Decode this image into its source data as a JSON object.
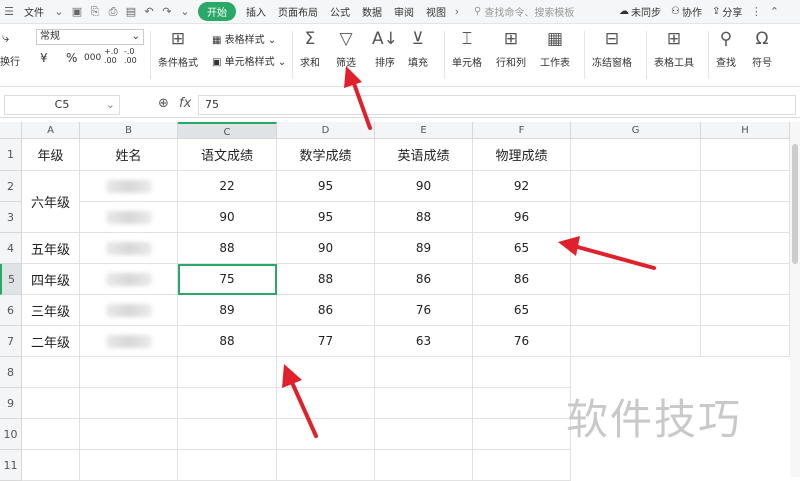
{
  "menu": {
    "file": "文件",
    "start": "开始",
    "tabs": [
      "插入",
      "页面布局",
      "公式",
      "数据",
      "审阅",
      "视图"
    ],
    "search_placeholder": "查找命令、搜索模板",
    "sync": "未同步",
    "collab": "协作",
    "share": "分享"
  },
  "ribbon": {
    "wrap": "换行",
    "format_value": "常规",
    "currency": "¥",
    "percent": "%",
    "thousands": "000",
    "dec_inc": "+.0 .00",
    "dec_dec": "-.0 .00",
    "cond_format": "条件格式",
    "table_style": "表格样式",
    "cell_style": "单元格样式",
    "sum": "求和",
    "filter": "筛选",
    "sort": "排序",
    "fill": "填充",
    "cell": "单元格",
    "row_col": "行和列",
    "sheet": "工作表",
    "freeze": "冻结窗格",
    "table_tools": "表格工具",
    "find": "查找",
    "symbol": "符号"
  },
  "formula_bar": {
    "name_box": "C5",
    "fx": "fx",
    "value": "75"
  },
  "columns": [
    "A",
    "B",
    "C",
    "D",
    "E",
    "F",
    "G",
    "H"
  ],
  "rows": [
    "1",
    "2",
    "3",
    "4",
    "5",
    "6",
    "7",
    "8",
    "9",
    "10",
    "11"
  ],
  "sheet": {
    "headers": [
      "年级",
      "姓名",
      "语文成绩",
      "数学成绩",
      "英语成绩",
      "物理成绩"
    ],
    "grades": [
      "六年级",
      "五年级",
      "四年级",
      "三年级",
      "二年级"
    ],
    "data": [
      [
        "22",
        "95",
        "90",
        "92"
      ],
      [
        "90",
        "95",
        "88",
        "96"
      ],
      [
        "88",
        "90",
        "89",
        "65"
      ],
      [
        "75",
        "88",
        "86",
        "86"
      ],
      [
        "89",
        "86",
        "76",
        "65"
      ],
      [
        "88",
        "77",
        "63",
        "76"
      ]
    ]
  },
  "watermark": "软件技巧",
  "accent_color": "#2aa868",
  "arrow_color": "#e0202a"
}
